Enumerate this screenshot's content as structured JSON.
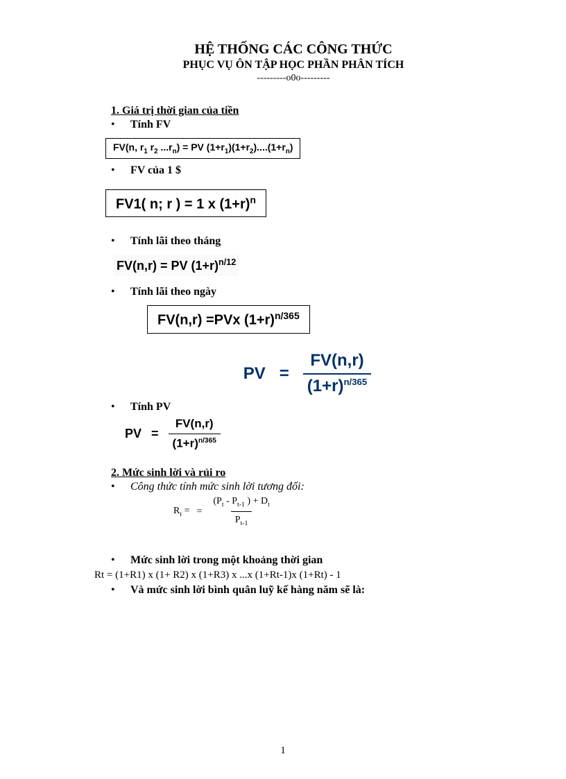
{
  "header": {
    "title1": "HỆ THỐNG CÁC CÔNG THỨC",
    "title2": "PHỤC VỤ ÔN TẬP HỌC PHẦN PHÂN TÍCH",
    "divider": "---------o0o---------"
  },
  "section1": {
    "heading": "1.  Giá trị thời gian của tiền",
    "bullet_fv": "Tính FV",
    "formula_fv_box_parts": {
      "pre": "FV(n, r",
      "sub1": "1",
      "mid1": " r",
      "sub2": "2",
      "mid2": " ...r",
      "subn": "n",
      "mid3": ") = PV (1+r",
      "s1": "1",
      "mid4": ")(1+r",
      "s2": "2",
      "mid5": ")....(1+r",
      "sn": "n",
      "end": ")"
    },
    "bullet_fv1": "FV của 1 $",
    "fv1_parts": {
      "pre": "FV1( n; r ) = 1 x (1+r)",
      "sup": "n"
    },
    "bullet_month": "Tính lãi theo tháng",
    "month_parts": {
      "pre": "FV(n,r) =  PV (1+r)",
      "sup": "n/12"
    },
    "bullet_day": "Tính lãi theo ngày",
    "day_parts": {
      "pre": "FV(n,r)  =PVx (1+r)",
      "sup": "n/365"
    },
    "navy_formula": {
      "lhs": "PV",
      "eq": "=",
      "num": "FV(n,r)",
      "den_base": "(1+r)",
      "den_sup": "n/365"
    },
    "bullet_pv": "Tính PV",
    "pv_small": {
      "lhs": "PV",
      "eq": "=",
      "num": "FV(n,r)",
      "den_base": "(1+r)",
      "den_sup": "n/365"
    }
  },
  "section2": {
    "heading": "2.  Mức sinh lời và rủi ro",
    "bullet_relative": "Công thức tính mức sinh lời tương đối:",
    "rt_formula": {
      "lhs_pre": "R",
      "lhs_sub": "t",
      "lhs_rest": " =",
      "eq2": "=",
      "num_pre": "(P",
      "num_sub1": "t",
      "num_mid": " - P",
      "num_sub2": "t-1",
      "num_mid2": "  ) + D",
      "num_sub3": "t",
      "den_pre": "P",
      "den_sub": "t-1"
    },
    "bullet_period": "Mức sinh lời  trong một khoảng thời gian",
    "rt_period_formula": "Rt = (1+R1) x (1+ R2) x (1+R3) x ...x (1+Rt-1)x (1+Rt) - 1",
    "bullet_annual": "Và mức sinh lời bình quân luỹ kế hàng năm sẽ là:"
  },
  "pageNumber": "1"
}
